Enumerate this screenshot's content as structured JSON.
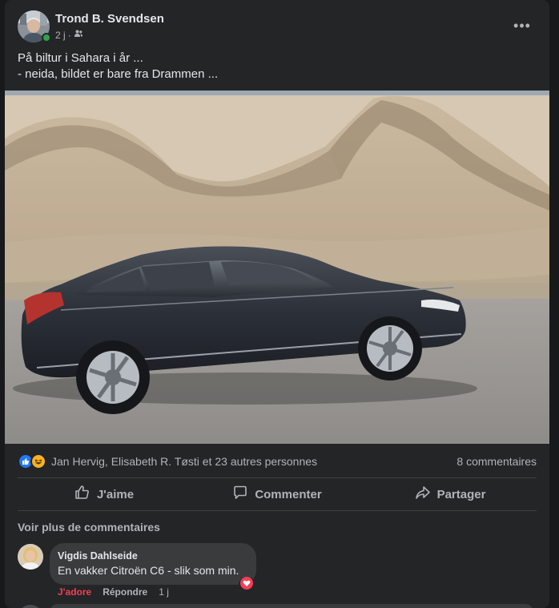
{
  "post": {
    "author": "Trond B. Svendsen",
    "time": "2 j",
    "audience_icon": "friends-icon",
    "text_line1": "På biltur i Sahara i år ...",
    "text_line2": "- neida, bildet er bare fra Drammen ..."
  },
  "reactions": {
    "icons": [
      "like-icon",
      "haha-icon"
    ],
    "names": "Jan Hervig, Elisabeth R. Tøsti et 23 autres personnes",
    "comment_count": "8 commentaires"
  },
  "actions": {
    "like": "J'aime",
    "comment": "Commenter",
    "share": "Partager"
  },
  "comments": {
    "more_label": "Voir plus de commentaires",
    "items": [
      {
        "author": "Vigdis Dahlseide",
        "text": "En vakker Citroën C6 - slik som min.",
        "like_label": "J'adore",
        "reply_label": "Répondre",
        "time": "1 j",
        "reaction_icon": "heart-icon"
      }
    ]
  },
  "colors": {
    "background": "#18191a",
    "card": "#242526",
    "bubble": "#3a3b3c",
    "text_primary": "#e4e6eb",
    "text_secondary": "#b0b3b8",
    "like_blue": "#2078f4",
    "love_red": "#f33e58",
    "online_green": "#31a24c"
  }
}
